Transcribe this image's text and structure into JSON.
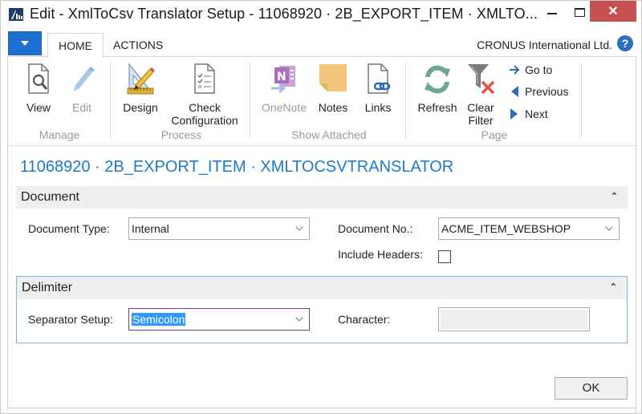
{
  "window": {
    "title": "Edit - XmlToCsv Translator Setup - 11068920 · 2B_EXPORT_ITEM · XMLTO...",
    "minimize_label": "",
    "close_label": "✕"
  },
  "ribbon_tabs": {
    "items": [
      {
        "label": "HOME"
      },
      {
        "label": "ACTIONS"
      }
    ],
    "company": "CRONUS International Ltd.",
    "help_label": "?"
  },
  "ribbon": {
    "groups": [
      {
        "label": "Manage",
        "buttons": [
          {
            "label": "View",
            "icon": "view-document-icon",
            "enabled": true
          },
          {
            "label": "Edit",
            "icon": "pencil-icon",
            "enabled": false
          }
        ]
      },
      {
        "label": "Process",
        "buttons": [
          {
            "label": "Design",
            "icon": "design-ruler-pencil-icon",
            "enabled": true
          },
          {
            "label_line1": "Check",
            "label_line2": "Configuration",
            "icon": "checklist-icon",
            "enabled": true
          }
        ]
      },
      {
        "label": "Show Attached",
        "buttons": [
          {
            "label": "OneNote",
            "icon": "onenote-icon",
            "enabled": false
          },
          {
            "label": "Notes",
            "icon": "note-icon",
            "enabled": true
          },
          {
            "label": "Links",
            "icon": "link-document-icon",
            "enabled": true
          }
        ]
      },
      {
        "label": "Page",
        "buttons": [
          {
            "label": "Refresh",
            "icon": "refresh-icon",
            "enabled": true
          },
          {
            "label_line1": "Clear",
            "label_line2": "Filter",
            "icon": "clear-filter-icon",
            "enabled": true
          }
        ],
        "small_buttons": [
          {
            "label": "Go to",
            "icon": "arrow-right-icon"
          },
          {
            "label": "Previous",
            "icon": "triangle-left-icon"
          },
          {
            "label": "Next",
            "icon": "triangle-right-icon"
          }
        ]
      }
    ]
  },
  "page": {
    "title": "11068920 · 2B_EXPORT_ITEM · XMLTOCSVTRANSLATOR"
  },
  "document_section": {
    "header": "Document",
    "fields": {
      "document_type": {
        "label": "Document Type:",
        "value": "Internal"
      },
      "document_no": {
        "label": "Document No.:",
        "value": "ACME_ITEM_WEBSHOP"
      },
      "include_headers": {
        "label": "Include Headers:",
        "checked": false
      }
    }
  },
  "delimiter_section": {
    "header": "Delimiter",
    "fields": {
      "separator_setup": {
        "label": "Separator Setup:",
        "value": "Semicolon"
      },
      "character": {
        "label": "Character:",
        "value": ""
      }
    }
  },
  "footer": {
    "ok_label": "OK"
  },
  "colors": {
    "accent_blue": "#1e7ac9",
    "menu_button": "#1d6fd0",
    "close_button": "#c75050",
    "selection": "#3399ff",
    "focus_border": "#8ab1e6"
  }
}
